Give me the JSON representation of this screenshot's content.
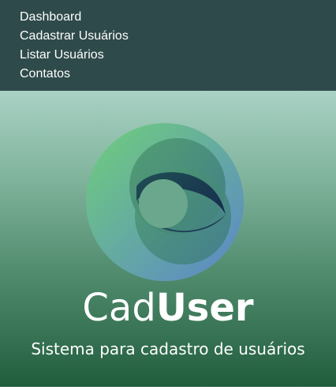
{
  "nav": {
    "items": [
      {
        "label": "Dashboard"
      },
      {
        "label": "Cadastrar Usuários"
      },
      {
        "label": "Listar Usuários"
      },
      {
        "label": "Contatos"
      }
    ]
  },
  "hero": {
    "brand_part1": "Cad",
    "brand_part2": "User",
    "subtitle": "Sistema para cadastro de usuários"
  },
  "colors": {
    "nav_bg": "#2f4a4a",
    "logo_green": "#6fcf7a",
    "logo_blue": "#5b86c9",
    "logo_dark": "#1e3d4a"
  }
}
